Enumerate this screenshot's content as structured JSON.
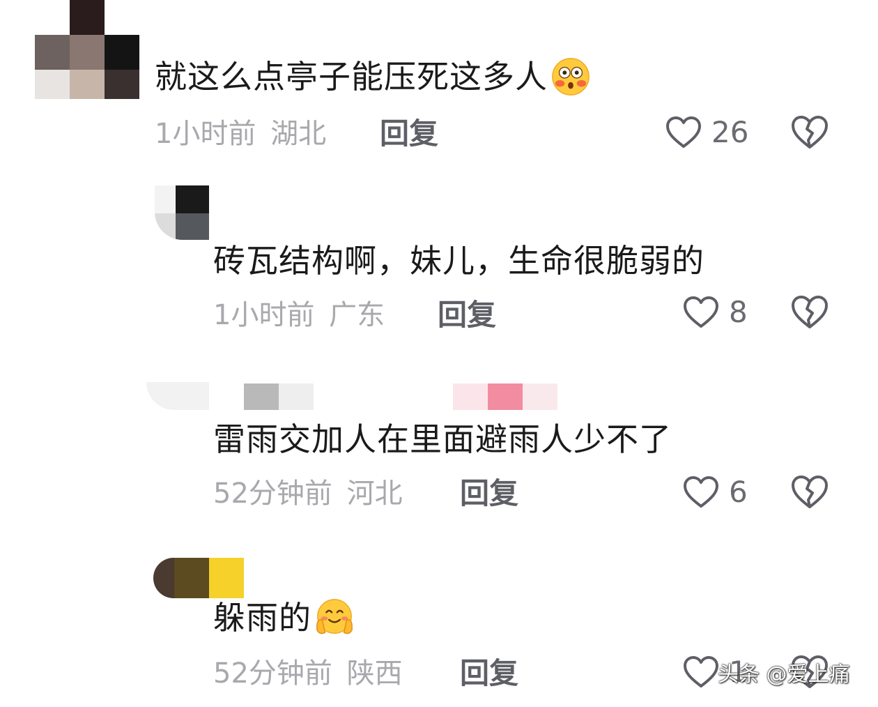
{
  "comments": [
    {
      "text": "就这么点亭子能压死这多人",
      "emoji": "flushed-face",
      "time": "1小时前",
      "location": "湖北",
      "reply_label": "回复",
      "likes": "26"
    },
    {
      "text": "砖瓦结构啊，妹儿，生命很脆弱的",
      "time": "1小时前",
      "location": "广东",
      "reply_label": "回复",
      "likes": "8"
    },
    {
      "text": "雷雨交加人在里面避雨人少不了",
      "time": "52分钟前",
      "location": "河北",
      "reply_label": "回复",
      "likes": "6"
    },
    {
      "text": "躲雨的",
      "emoji": "smiling-face-hands-on-cheeks",
      "time": "52分钟前",
      "location": "陕西",
      "reply_label": "回复",
      "likes": "1"
    }
  ],
  "watermark": "头条 @爱上痛",
  "colors": {
    "text": "#1a1a1a",
    "meta": "#a8a8ad",
    "reply": "#5e5e66",
    "icon": "#5e5e66"
  }
}
